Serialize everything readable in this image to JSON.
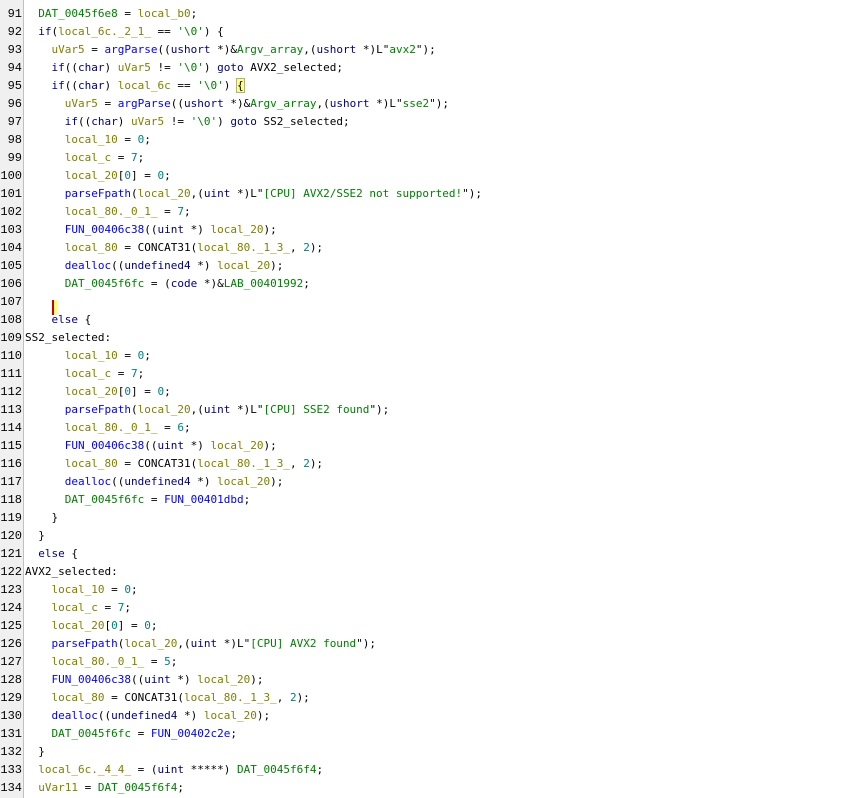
{
  "palette": {
    "keyword": "#000080",
    "function": "#0000ff",
    "local_variable": "#808000",
    "global": "#008000",
    "string": "#008000",
    "number": "#008080",
    "gutter_bg": "#f0f0f0",
    "brace_highlight": "#ffff80",
    "cursor": "#d00000"
  },
  "lines": [
    {
      "n": "91",
      "indent": 1,
      "tokens": [
        [
          "glb",
          "DAT_0045f6e8"
        ],
        [
          "",
          "="
        ],
        [
          "var",
          "local_b0"
        ],
        [
          "",
          ";"
        ]
      ]
    },
    {
      "n": "92",
      "indent": 1,
      "tokens": [
        [
          "kw",
          "if"
        ],
        [
          "",
          "("
        ],
        [
          "var",
          "local_6c._2_1_"
        ],
        [
          "",
          "=="
        ],
        [
          "str",
          "'\\0'"
        ],
        [
          "",
          ") {"
        ]
      ]
    },
    {
      "n": "93",
      "indent": 2,
      "tokens": [
        [
          "var",
          "uVar5"
        ],
        [
          "",
          "="
        ],
        [
          "fn",
          "argParse"
        ],
        [
          "",
          "(("
        ],
        [
          "type",
          "ushort"
        ],
        [
          "",
          "*)&"
        ],
        [
          "glb",
          "Argv_array"
        ],
        [
          "",
          ",("
        ],
        [
          "type",
          "ushort"
        ],
        [
          "",
          "*)L\""
        ],
        [
          "str",
          "avx2"
        ],
        [
          "",
          "\");"
        ]
      ]
    },
    {
      "n": "94",
      "indent": 2,
      "tokens": [
        [
          "kw",
          "if"
        ],
        [
          "",
          "(("
        ],
        [
          "type",
          "char"
        ],
        [
          "",
          ")"
        ],
        [
          "var",
          "uVar5"
        ],
        [
          "",
          "!="
        ],
        [
          "str",
          "'\\0'"
        ],
        [
          "",
          ")"
        ],
        [
          "kw",
          "goto"
        ],
        [
          "lbl",
          "AVX2_selected"
        ],
        [
          "",
          ";"
        ]
      ]
    },
    {
      "n": "95",
      "indent": 2,
      "tokens": [
        [
          "kw",
          "if"
        ],
        [
          "",
          "(("
        ],
        [
          "type",
          "char"
        ],
        [
          "",
          ")"
        ],
        [
          "var",
          "local_6c"
        ],
        [
          "",
          "=="
        ],
        [
          "str",
          "'\\0'"
        ],
        [
          "",
          ")"
        ],
        [
          "brace",
          "{"
        ]
      ]
    },
    {
      "n": "96",
      "indent": 3,
      "tokens": [
        [
          "var",
          "uVar5"
        ],
        [
          "",
          "="
        ],
        [
          "fn",
          "argParse"
        ],
        [
          "",
          "(("
        ],
        [
          "type",
          "ushort"
        ],
        [
          "",
          "*)&"
        ],
        [
          "glb",
          "Argv_array"
        ],
        [
          "",
          ",("
        ],
        [
          "type",
          "ushort"
        ],
        [
          "",
          "*)L\""
        ],
        [
          "str",
          "sse2"
        ],
        [
          "",
          "\");"
        ]
      ]
    },
    {
      "n": "97",
      "indent": 3,
      "tokens": [
        [
          "kw",
          "if"
        ],
        [
          "",
          "(("
        ],
        [
          "type",
          "char"
        ],
        [
          "",
          ")"
        ],
        [
          "var",
          "uVar5"
        ],
        [
          "",
          "!="
        ],
        [
          "str",
          "'\\0'"
        ],
        [
          "",
          ")"
        ],
        [
          "kw",
          "goto"
        ],
        [
          "lbl",
          "SS2_selected"
        ],
        [
          "",
          ";"
        ]
      ]
    },
    {
      "n": "98",
      "indent": 3,
      "tokens": [
        [
          "var",
          "local_10"
        ],
        [
          "",
          "="
        ],
        [
          "num",
          "0"
        ],
        [
          "",
          ";"
        ]
      ]
    },
    {
      "n": "99",
      "indent": 3,
      "tokens": [
        [
          "var",
          "local_c"
        ],
        [
          "",
          "="
        ],
        [
          "num",
          "7"
        ],
        [
          "",
          ";"
        ]
      ]
    },
    {
      "n": "100",
      "indent": 3,
      "tokens": [
        [
          "var",
          "local_20"
        ],
        [
          "",
          "["
        ],
        [
          "num",
          "0"
        ],
        [
          "",
          "] ="
        ],
        [
          "num",
          "0"
        ],
        [
          "",
          ";"
        ]
      ]
    },
    {
      "n": "101",
      "indent": 3,
      "tokens": [
        [
          "fn",
          "parseFpath"
        ],
        [
          "",
          "("
        ],
        [
          "var",
          "local_20"
        ],
        [
          "",
          ",("
        ],
        [
          "type",
          "uint"
        ],
        [
          "",
          "*)L\""
        ],
        [
          "str",
          "[CPU] AVX2/SSE2 not supported!"
        ],
        [
          "",
          "\");"
        ]
      ]
    },
    {
      "n": "102",
      "indent": 3,
      "tokens": [
        [
          "var",
          "local_80._0_1_"
        ],
        [
          "",
          "="
        ],
        [
          "num",
          "7"
        ],
        [
          "",
          ";"
        ]
      ]
    },
    {
      "n": "103",
      "indent": 3,
      "tokens": [
        [
          "fn",
          "FUN_00406c38"
        ],
        [
          "",
          "(("
        ],
        [
          "type",
          "uint"
        ],
        [
          "",
          "*)"
        ],
        [
          "var",
          "local_20"
        ],
        [
          "",
          ");"
        ]
      ]
    },
    {
      "n": "104",
      "indent": 3,
      "tokens": [
        [
          "var",
          "local_80"
        ],
        [
          "",
          "="
        ],
        [
          "",
          "CONCAT31("
        ],
        [
          "var",
          "local_80._1_3_"
        ],
        [
          "",
          ","
        ],
        [
          "num",
          "2"
        ],
        [
          "",
          ");"
        ]
      ]
    },
    {
      "n": "105",
      "indent": 3,
      "tokens": [
        [
          "fn",
          "dealloc"
        ],
        [
          "",
          "(("
        ],
        [
          "type",
          "undefined4"
        ],
        [
          "",
          "*)"
        ],
        [
          "var",
          "local_20"
        ],
        [
          "",
          ");"
        ]
      ]
    },
    {
      "n": "106",
      "indent": 3,
      "tokens": [
        [
          "glb",
          "DAT_0045f6fc"
        ],
        [
          "",
          "= ("
        ],
        [
          "type",
          "code"
        ],
        [
          "",
          "*)&"
        ],
        [
          "glb",
          "LAB_00401992"
        ],
        [
          "",
          ";"
        ]
      ]
    },
    {
      "n": "107",
      "indent": 2,
      "tokens": [
        [
          "caret",
          "}"
        ]
      ]
    },
    {
      "n": "108",
      "indent": 2,
      "tokens": [
        [
          "kw",
          "else"
        ],
        [
          "",
          "{"
        ]
      ]
    },
    {
      "n": "109",
      "indent": 0,
      "tokens": [
        [
          "lbl",
          "SS2_selected:"
        ]
      ]
    },
    {
      "n": "110",
      "indent": 3,
      "tokens": [
        [
          "var",
          "local_10"
        ],
        [
          "",
          "="
        ],
        [
          "num",
          "0"
        ],
        [
          "",
          ";"
        ]
      ]
    },
    {
      "n": "111",
      "indent": 3,
      "tokens": [
        [
          "var",
          "local_c"
        ],
        [
          "",
          "="
        ],
        [
          "num",
          "7"
        ],
        [
          "",
          ";"
        ]
      ]
    },
    {
      "n": "112",
      "indent": 3,
      "tokens": [
        [
          "var",
          "local_20"
        ],
        [
          "",
          "["
        ],
        [
          "num",
          "0"
        ],
        [
          "",
          "] ="
        ],
        [
          "num",
          "0"
        ],
        [
          "",
          ";"
        ]
      ]
    },
    {
      "n": "113",
      "indent": 3,
      "tokens": [
        [
          "fn",
          "parseFpath"
        ],
        [
          "",
          "("
        ],
        [
          "var",
          "local_20"
        ],
        [
          "",
          ",("
        ],
        [
          "type",
          "uint"
        ],
        [
          "",
          "*)L\""
        ],
        [
          "str",
          "[CPU] SSE2 found"
        ],
        [
          "",
          "\");"
        ]
      ]
    },
    {
      "n": "114",
      "indent": 3,
      "tokens": [
        [
          "var",
          "local_80._0_1_"
        ],
        [
          "",
          "="
        ],
        [
          "num",
          "6"
        ],
        [
          "",
          ";"
        ]
      ]
    },
    {
      "n": "115",
      "indent": 3,
      "tokens": [
        [
          "fn",
          "FUN_00406c38"
        ],
        [
          "",
          "(("
        ],
        [
          "type",
          "uint"
        ],
        [
          "",
          "*)"
        ],
        [
          "var",
          "local_20"
        ],
        [
          "",
          ");"
        ]
      ]
    },
    {
      "n": "116",
      "indent": 3,
      "tokens": [
        [
          "var",
          "local_80"
        ],
        [
          "",
          "="
        ],
        [
          "",
          "CONCAT31("
        ],
        [
          "var",
          "local_80._1_3_"
        ],
        [
          "",
          ","
        ],
        [
          "num",
          "2"
        ],
        [
          "",
          ");"
        ]
      ]
    },
    {
      "n": "117",
      "indent": 3,
      "tokens": [
        [
          "fn",
          "dealloc"
        ],
        [
          "",
          "(("
        ],
        [
          "type",
          "undefined4"
        ],
        [
          "",
          "*)"
        ],
        [
          "var",
          "local_20"
        ],
        [
          "",
          ");"
        ]
      ]
    },
    {
      "n": "118",
      "indent": 3,
      "tokens": [
        [
          "glb",
          "DAT_0045f6fc"
        ],
        [
          "",
          "="
        ],
        [
          "fn",
          "FUN_00401dbd"
        ],
        [
          "",
          ";"
        ]
      ]
    },
    {
      "n": "119",
      "indent": 2,
      "tokens": [
        [
          "",
          "}"
        ]
      ]
    },
    {
      "n": "120",
      "indent": 1,
      "tokens": [
        [
          "",
          "}"
        ]
      ]
    },
    {
      "n": "121",
      "indent": 1,
      "tokens": [
        [
          "kw",
          "else"
        ],
        [
          "",
          "{"
        ]
      ]
    },
    {
      "n": "122",
      "indent": 0,
      "tokens": [
        [
          "lbl",
          "AVX2_selected:"
        ]
      ]
    },
    {
      "n": "123",
      "indent": 2,
      "tokens": [
        [
          "var",
          "local_10"
        ],
        [
          "",
          "="
        ],
        [
          "num",
          "0"
        ],
        [
          "",
          ";"
        ]
      ]
    },
    {
      "n": "124",
      "indent": 2,
      "tokens": [
        [
          "var",
          "local_c"
        ],
        [
          "",
          "="
        ],
        [
          "num",
          "7"
        ],
        [
          "",
          ";"
        ]
      ]
    },
    {
      "n": "125",
      "indent": 2,
      "tokens": [
        [
          "var",
          "local_20"
        ],
        [
          "",
          "["
        ],
        [
          "num",
          "0"
        ],
        [
          "",
          "] ="
        ],
        [
          "num",
          "0"
        ],
        [
          "",
          ";"
        ]
      ]
    },
    {
      "n": "126",
      "indent": 2,
      "tokens": [
        [
          "fn",
          "parseFpath"
        ],
        [
          "",
          "("
        ],
        [
          "var",
          "local_20"
        ],
        [
          "",
          ",("
        ],
        [
          "type",
          "uint"
        ],
        [
          "",
          "*)L\""
        ],
        [
          "str",
          "[CPU] AVX2 found"
        ],
        [
          "",
          "\");"
        ]
      ]
    },
    {
      "n": "127",
      "indent": 2,
      "tokens": [
        [
          "var",
          "local_80._0_1_"
        ],
        [
          "",
          "="
        ],
        [
          "num",
          "5"
        ],
        [
          "",
          ";"
        ]
      ]
    },
    {
      "n": "128",
      "indent": 2,
      "tokens": [
        [
          "fn",
          "FUN_00406c38"
        ],
        [
          "",
          "(("
        ],
        [
          "type",
          "uint"
        ],
        [
          "",
          "*)"
        ],
        [
          "var",
          "local_20"
        ],
        [
          "",
          ");"
        ]
      ]
    },
    {
      "n": "129",
      "indent": 2,
      "tokens": [
        [
          "var",
          "local_80"
        ],
        [
          "",
          "="
        ],
        [
          "",
          "CONCAT31("
        ],
        [
          "var",
          "local_80._1_3_"
        ],
        [
          "",
          ","
        ],
        [
          "num",
          "2"
        ],
        [
          "",
          ");"
        ]
      ]
    },
    {
      "n": "130",
      "indent": 2,
      "tokens": [
        [
          "fn",
          "dealloc"
        ],
        [
          "",
          "(("
        ],
        [
          "type",
          "undefined4"
        ],
        [
          "",
          "*)"
        ],
        [
          "var",
          "local_20"
        ],
        [
          "",
          ");"
        ]
      ]
    },
    {
      "n": "131",
      "indent": 2,
      "tokens": [
        [
          "glb",
          "DAT_0045f6fc"
        ],
        [
          "",
          "="
        ],
        [
          "fn",
          "FUN_00402c2e"
        ],
        [
          "",
          ";"
        ]
      ]
    },
    {
      "n": "132",
      "indent": 1,
      "tokens": [
        [
          "",
          "}"
        ]
      ]
    },
    {
      "n": "133",
      "indent": 1,
      "tokens": [
        [
          "var",
          "local_6c._4_4_"
        ],
        [
          "",
          "= ("
        ],
        [
          "type",
          "uint"
        ],
        [
          "",
          "*****)"
        ],
        [
          "glb",
          "DAT_0045f6f4"
        ],
        [
          "",
          ";"
        ]
      ]
    },
    {
      "n": "134",
      "indent": 1,
      "tokens": [
        [
          "var",
          "uVar11"
        ],
        [
          "",
          "="
        ],
        [
          "glb",
          "DAT_0045f6f4"
        ],
        [
          "",
          ";"
        ]
      ]
    }
  ]
}
